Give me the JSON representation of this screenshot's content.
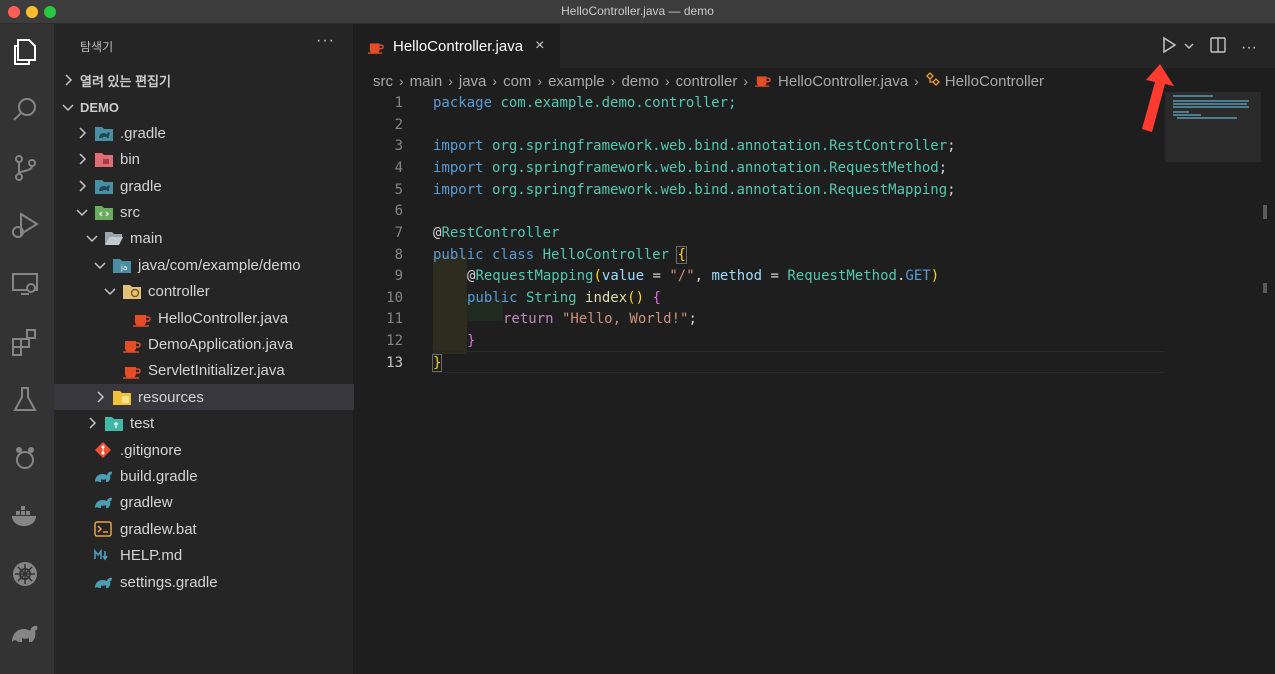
{
  "window": {
    "title": "HelloController.java — demo"
  },
  "activity_bar": {
    "icons": [
      "explorer-icon",
      "search-icon",
      "source-control-icon",
      "run-debug-icon",
      "remote-explorer-icon",
      "extensions-icon",
      "testing-icon",
      "spring-boot-icon",
      "docker-icon",
      "kubernetes-icon",
      "gradle-icon"
    ]
  },
  "sidebar": {
    "title": "탐색기",
    "more": "···",
    "open_editors": "열려 있는 편집기",
    "project": "DEMO",
    "items": [
      {
        "label": ".gradle",
        "icon": "gradle-folder-icon"
      },
      {
        "label": "bin",
        "icon": "bin-folder-icon"
      },
      {
        "label": "gradle",
        "icon": "gradle-folder-icon"
      },
      {
        "label": "src",
        "icon": "src-folder-icon"
      },
      {
        "label": "main",
        "icon": "folder-open-icon"
      },
      {
        "label": "java/com/example/demo",
        "icon": "java-package-icon"
      },
      {
        "label": "controller",
        "icon": "controller-folder-icon"
      },
      {
        "label": "HelloController.java",
        "icon": "java-file-icon"
      },
      {
        "label": "DemoApplication.java",
        "icon": "java-file-icon"
      },
      {
        "label": "ServletInitializer.java",
        "icon": "java-file-icon"
      },
      {
        "label": "resources",
        "icon": "resources-folder-icon"
      },
      {
        "label": "test",
        "icon": "test-folder-icon"
      },
      {
        "label": ".gitignore",
        "icon": "git-icon"
      },
      {
        "label": "build.gradle",
        "icon": "gradle-file-icon"
      },
      {
        "label": "gradlew",
        "icon": "gradle-file-icon"
      },
      {
        "label": "gradlew.bat",
        "icon": "terminal-file-icon"
      },
      {
        "label": "HELP.md",
        "icon": "markdown-icon"
      },
      {
        "label": "settings.gradle",
        "icon": "gradle-file-icon"
      }
    ]
  },
  "editor": {
    "tab_label": "HelloController.java",
    "tab_close": "×",
    "breadcrumb": [
      "src",
      "main",
      "java",
      "com",
      "example",
      "demo",
      "controller",
      "HelloController.java",
      "HelloController"
    ],
    "line_numbers": [
      "1",
      "2",
      "3",
      "4",
      "5",
      "6",
      "7",
      "8",
      "9",
      "10",
      "11",
      "12",
      "13"
    ],
    "active_line": "13",
    "code": {
      "l1_kw": "package",
      "l1_rest": " com.example.demo.controller;",
      "imp_kw": "import",
      "l3_pkg": " org.springframework.web.bind.annotation.",
      "l3_cls": "RestController",
      "l4_cls": "RequestMethod",
      "l5_cls": "RequestMapping",
      "semi": ";",
      "at": "@",
      "l7_ann": "RestController",
      "l8_mod": "public class",
      "l8_name": " HelloController ",
      "l8_brace": "{",
      "l9_ann": "RequestMapping",
      "l9_open": "(",
      "l9_value": "value",
      "l9_eq": " = ",
      "l9_str": "\"/\"",
      "l9_comma": ", ",
      "l9_method": "method",
      "l9_enum": "RequestMethod",
      "l9_dot": ".",
      "l9_get": "GET",
      "l9_close": ")",
      "l10_pub": "public",
      "l10_type": " String",
      "l10_fn": " index",
      "l10_parens": "()",
      "l10_brace": " {",
      "l11_ret": "return",
      "l11_str": " \"Hello, World!\"",
      "l11_semi": ";",
      "l12_brace": "}",
      "l13_brace": "}"
    }
  },
  "colors": {
    "keyword": "#569cd6",
    "type": "#4ec9b0",
    "string": "#ce9178",
    "annotation_arrow": "#ff3b30"
  }
}
